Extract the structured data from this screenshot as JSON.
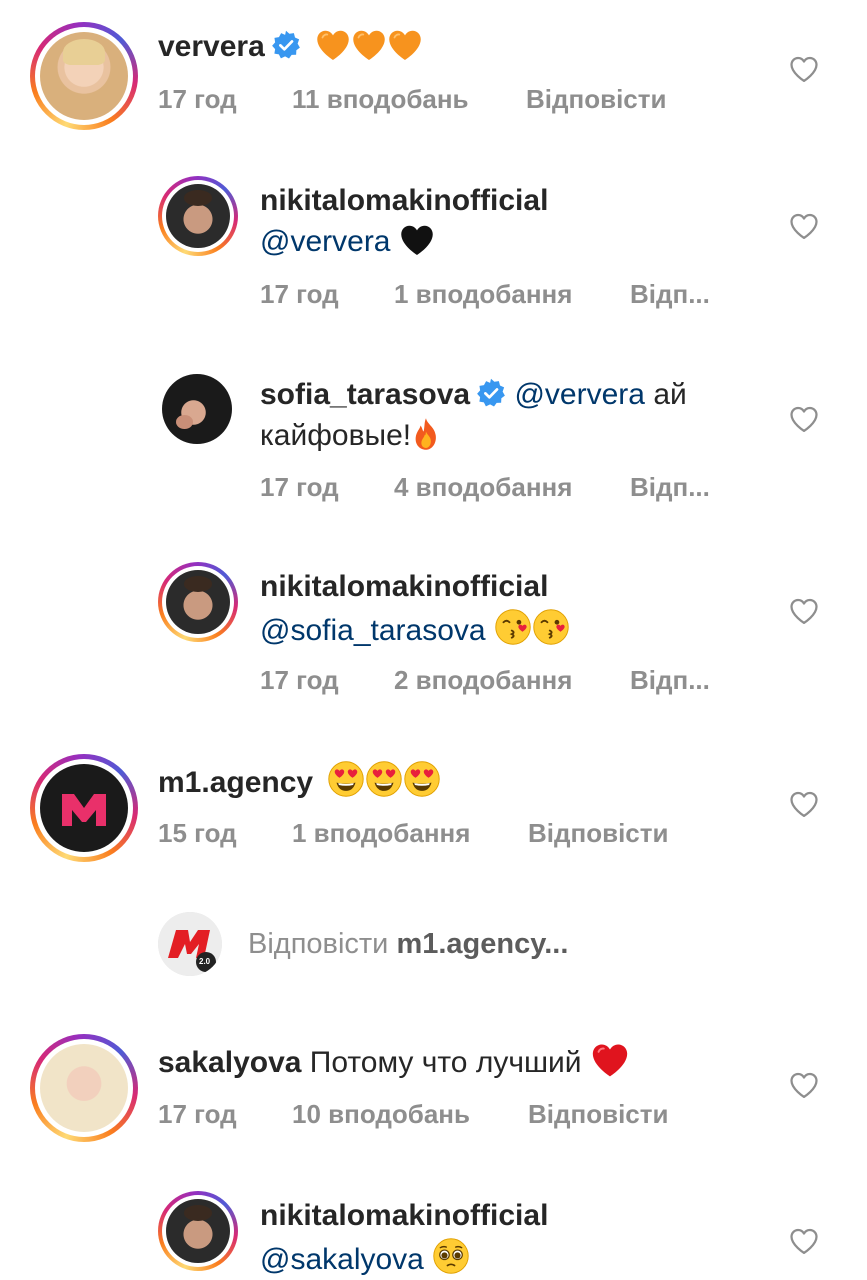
{
  "colors": {
    "accent_link": "#00376b",
    "meta_gray": "#8e8e8e",
    "text": "#262626",
    "verified_blue": "#3897f0"
  },
  "comments": [
    {
      "username": "ververa",
      "verified": true,
      "text": "",
      "emojis": [
        "orange-heart",
        "orange-heart",
        "orange-heart"
      ],
      "time": "17 год",
      "likes": "11 вподобань",
      "reply": "Відповісти"
    },
    {
      "username": "nikitalomakinofficial",
      "mention": "@ververa",
      "emojis": [
        "black-heart"
      ],
      "time": "17 год",
      "likes": "1 вподобання",
      "reply": "Відп..."
    },
    {
      "username": "sofia_tarasova",
      "verified": true,
      "mention": "@ververa",
      "text_a": "ай",
      "text_b": "кайфовые!",
      "emojis": [
        "fire"
      ],
      "time": "17 год",
      "likes": "4 вподобання",
      "reply": "Відп..."
    },
    {
      "username": "nikitalomakinofficial",
      "mention": "@sofia_tarasova",
      "emojis": [
        "kissing-face",
        "kissing-face"
      ],
      "time": "17 год",
      "likes": "2 вподобання",
      "reply": "Відп..."
    },
    {
      "username": "m1.agency",
      "emojis": [
        "heart-eyes",
        "heart-eyes",
        "heart-eyes"
      ],
      "time": "15 год",
      "likes": "1 вподобання",
      "reply": "Відповісти"
    },
    {
      "username": "sakalyova",
      "text": "Потому что лучший",
      "emojis": [
        "red-heart"
      ],
      "time": "17 год",
      "likes": "10 вподобань",
      "reply": "Відповісти"
    },
    {
      "username": "nikitalomakinofficial",
      "mention": "@sakalyova",
      "emojis": [
        "pleading-face"
      ]
    }
  ],
  "reply_prompt": {
    "prefix": "Відповісти",
    "target": "m1.agency..."
  },
  "avatar_badge": "2.0",
  "icons": {
    "like": "heart-outline-icon",
    "verified": "verified-badge-icon"
  }
}
